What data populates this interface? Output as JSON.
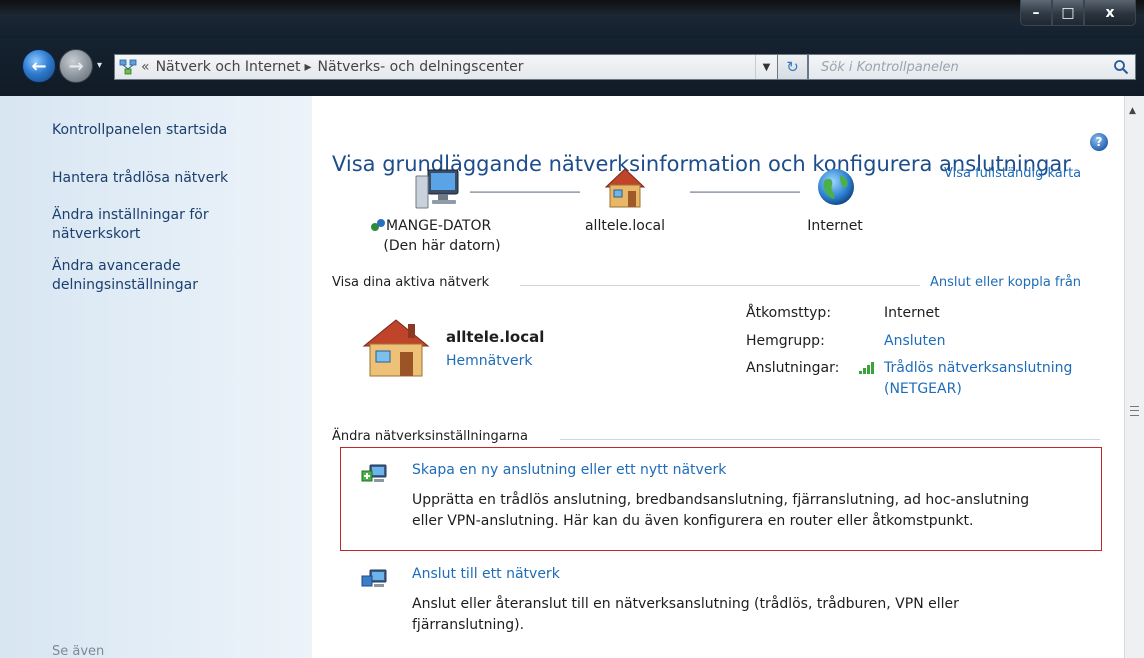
{
  "window": {
    "minimize_label": "–",
    "maximize_label": "□",
    "close_label": "x"
  },
  "address_bar": {
    "overflow": "«",
    "crumbs": [
      "Nätverk och Internet",
      "Nätverks- och delningscenter"
    ],
    "separator": "▸",
    "search_placeholder": "Sök i Kontrollpanelen"
  },
  "sidebar": {
    "items": [
      {
        "label": "Kontrollpanelen startsida"
      },
      {
        "label": "Hantera trådlösa nätverk"
      },
      {
        "label": "Ändra inställningar för nätverkskort"
      },
      {
        "label": "Ändra avancerade delningsinställningar"
      }
    ],
    "see_also": "Se även"
  },
  "main": {
    "title": "Visa grundläggande nätverksinformation och konfigurera anslutningar",
    "full_map_link": "Visa fullständig karta",
    "map": {
      "computer_name": "MANGE-DATOR",
      "computer_sub": "(Den här datorn)",
      "network_name": "alltele.local",
      "internet_label": "Internet"
    },
    "active_networks": {
      "heading": "Visa dina aktiva nätverk",
      "connect_link": "Anslut eller koppla från",
      "network_name": "alltele.local",
      "network_type": "Hemnätverk",
      "access_type_key": "Åtkomsttyp:",
      "access_type_value": "Internet",
      "homegroup_key": "Hemgrupp:",
      "homegroup_value": "Ansluten",
      "connections_key": "Anslutningar:",
      "connections_value_line1": "Trådlös nätverksanslutning",
      "connections_value_line2": "(NETGEAR)"
    },
    "change_settings": {
      "heading": "Ändra nätverksinställningarna",
      "tasks": [
        {
          "title": "Skapa en ny anslutning eller ett nytt nätverk",
          "desc_line1": "Upprätta en trådlös anslutning, bredbandsanslutning, fjärranslutning, ad hoc-anslutning",
          "desc_line2": "eller VPN-anslutning. Här kan du även konfigurera en router eller åtkomstpunkt."
        },
        {
          "title": "Anslut till ett nätverk",
          "desc_line1": "Anslut eller återanslut till en nätverksanslutning (trådlös, trådburen, VPN eller",
          "desc_line2": "fjärranslutning)."
        }
      ]
    }
  },
  "colors": {
    "link": "#1f6cb8",
    "title": "#1d4d8b",
    "highlight_border": "#c0262c"
  }
}
